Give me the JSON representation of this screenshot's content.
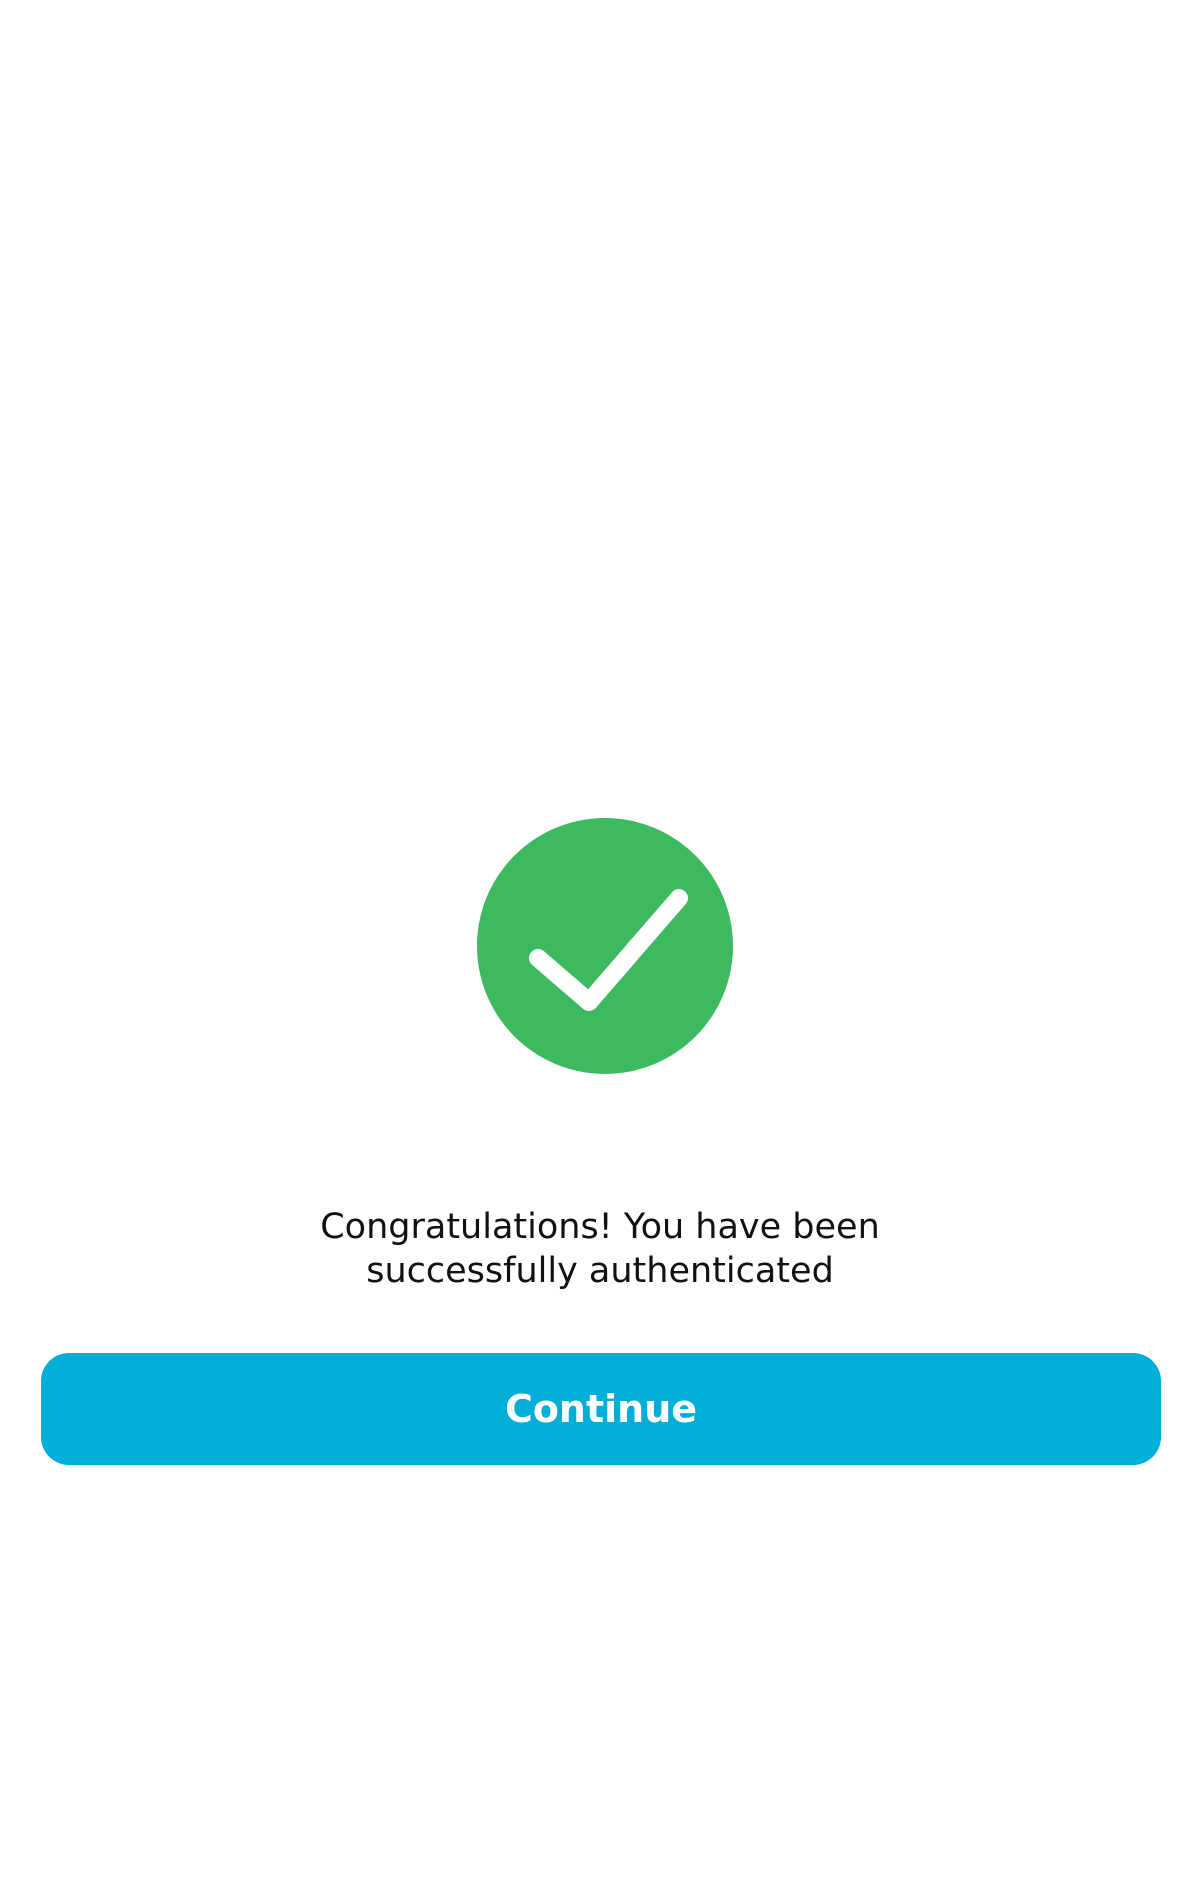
{
  "success": {
    "icon": "check-circle-icon",
    "circle_color": "#3dba5f",
    "check_color": "#ffffff"
  },
  "message": {
    "line1": "Congratulations! You have been",
    "line2": "successfully authenticated"
  },
  "continue_button": {
    "label": "Continue",
    "color": "#00aed8"
  }
}
